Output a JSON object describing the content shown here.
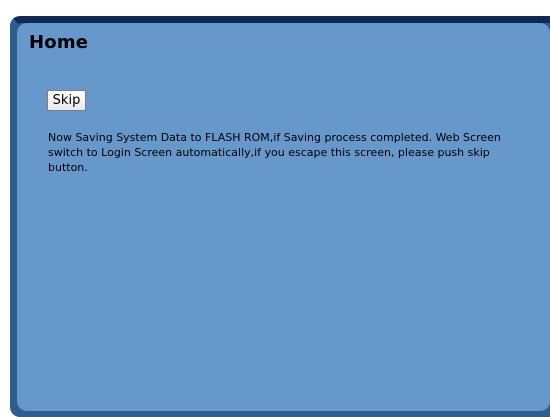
{
  "panel": {
    "title": "Home",
    "skip_label": "Skip",
    "message": "Now Saving System Data to FLASH ROM,if Saving process completed. Web Screen switch to Login Screen automatically,if you escape this screen, please push skip button."
  },
  "colors": {
    "frame_dark": "#0f2b55",
    "frame": "#2f5d8e",
    "panel_bg": "#6698cc"
  }
}
